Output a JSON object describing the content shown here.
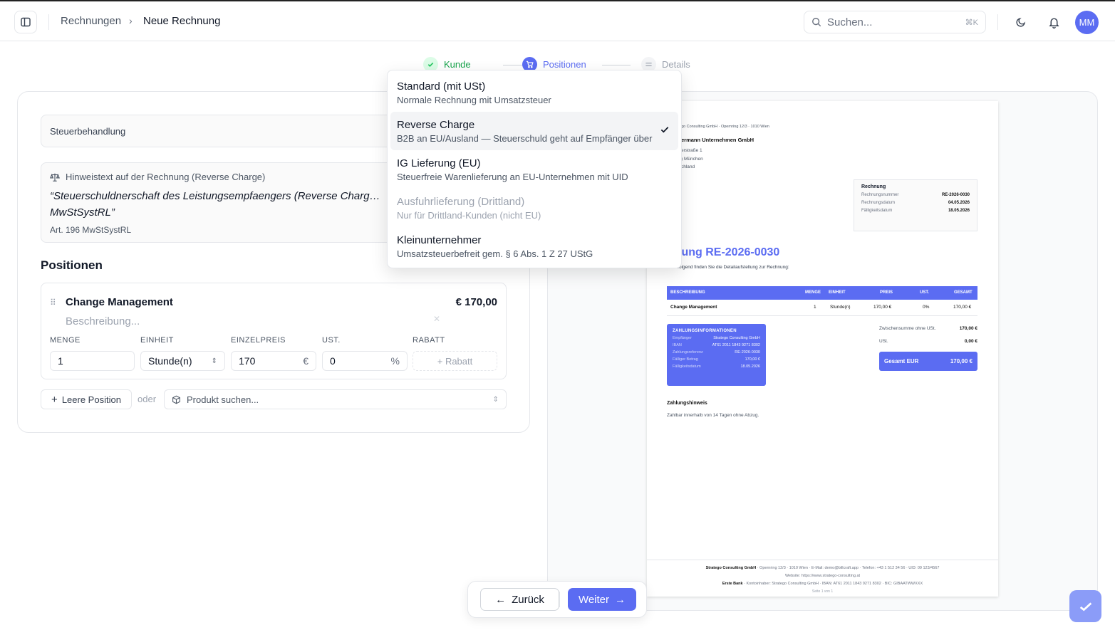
{
  "header": {
    "breadcrumb": [
      "Rechnungen",
      "Neue Rechnung"
    ],
    "search_placeholder": "Suchen...",
    "search_shortcut": "⌘K",
    "avatar_initials": "MM"
  },
  "stepper": {
    "steps": [
      "Kunde",
      "Positionen",
      "Details"
    ]
  },
  "tax": {
    "label": "Steuerbehandlung",
    "hint_title": "Hinweistext auf der Rechnung (Reverse Charge)",
    "hint_text": "“Steuerschuldnerschaft des Leistungsempfaengers (Reverse Charg… MwStSystRL”",
    "hint_ref": "Art. 196 MwStSystRL"
  },
  "dropdown": {
    "options": [
      {
        "label": "Standard (mit USt)",
        "desc": "Normale Rechnung mit Umsatzsteuer"
      },
      {
        "label": "Reverse Charge",
        "desc": "B2B an EU/Ausland — Steuerschuld geht auf Empfänger über"
      },
      {
        "label": "IG Lieferung (EU)",
        "desc": "Steuerfreie Warenlieferung an EU-Unternehmen mit UID"
      },
      {
        "label": "Ausfuhrlieferung (Drittland)",
        "desc": "Nur für Drittland-Kunden (nicht EU)"
      },
      {
        "label": "Kleinunternehmer",
        "desc": "Umsatzsteuerbefreit gem. § 6 Abs. 1 Z 27 UStG"
      }
    ],
    "selected_index": 1
  },
  "positions": {
    "title": "Positionen",
    "item": {
      "name": "Change Management",
      "price": "€ 170,00",
      "desc_placeholder": "Beschreibung...",
      "labels": {
        "qty": "MENGE",
        "unit": "EINHEIT",
        "price": "EINZELPREIS",
        "vat": "UST.",
        "discount": "RABATT"
      },
      "qty": "1",
      "unit": "Stunde(n)",
      "unit_price": "170",
      "currency": "€",
      "vat": "0",
      "vat_unit": "%",
      "discount_btn": "+ Rabatt"
    },
    "add_empty": "Leere Position",
    "or": "oder",
    "product_search": "Produkt suchen..."
  },
  "preview": {
    "sender_line": "go Consulting GmbH · Opernring 12/3 · 1010 Wien",
    "recipient": [
      "ermann Unternehmen GmbH",
      "erstraße 1",
      ") München",
      "chland"
    ],
    "info_title": "Rechnung",
    "info": [
      {
        "k": "Rechnungsnummer",
        "v": "RE-2026-0030"
      },
      {
        "k": "Rechnungsdatum",
        "v": "04.05.2026"
      },
      {
        "k": "Fälligkeitsdatum",
        "v": "18.05.2026"
      }
    ],
    "title": "chnung RE-2026-0030",
    "intro": "Nachfolgend finden Sie die Detailaufstellung zur Rechnung:",
    "table_head": [
      "BESCHREIBUNG",
      "MENGE",
      "EINHEIT",
      "PREIS",
      "UST.",
      "GESAMT"
    ],
    "table_row": [
      "Change Management",
      "1",
      "Stunde(n)",
      "170,00 €",
      "0%",
      "170,00 €"
    ],
    "pay_title": "ZAHLUNGSINFORMATIONEN",
    "pay": [
      {
        "k": "Empfänger",
        "v": "Stratego Consulting GmbH"
      },
      {
        "k": "IBAN",
        "v": "AT61 2011 1843 9271 8302"
      },
      {
        "k": "Zahlungsreferenz",
        "v": "RE-2026-0030"
      },
      {
        "k": "Fälliger Betrag",
        "v": "170,00 €"
      },
      {
        "k": "Fälligkeitsdatum",
        "v": "18.05.2026"
      }
    ],
    "subtotal_label": "Zwischensumme ohne USt.",
    "subtotal": "170,00 €",
    "vat_label": "USt.",
    "vat": "0,00 €",
    "total_label": "Gesamt EUR",
    "total": "170,00 €",
    "note_title": "Zahlungshinweis",
    "note_text": "Zahlbar innerhalb von 14 Tagen ohne Abzug.",
    "footer_1_bold": "Stratego Consulting GmbH",
    "footer_1": " · Opernring 12/3 · 1010 Wien · E-Mail: demo@billcraft.app · Telefon: +43 1 512 34 56 · UID: 09 123/4567",
    "footer_2": "Website: https://www.stratego-consulting.at",
    "footer_3_bold": "Erste Bank",
    "footer_3": " · Kontoinhaber: Stratego Consulting GmbH · IBAN: AT61 2011 1843 9271 8302 · BIC: GIBAATWWXXX",
    "footer_page": "Seite 1 von 1"
  },
  "nav": {
    "back": "Zurück",
    "next": "Weiter"
  },
  "colors": {
    "accent": "#5b6cf2",
    "success": "#22c55e"
  }
}
